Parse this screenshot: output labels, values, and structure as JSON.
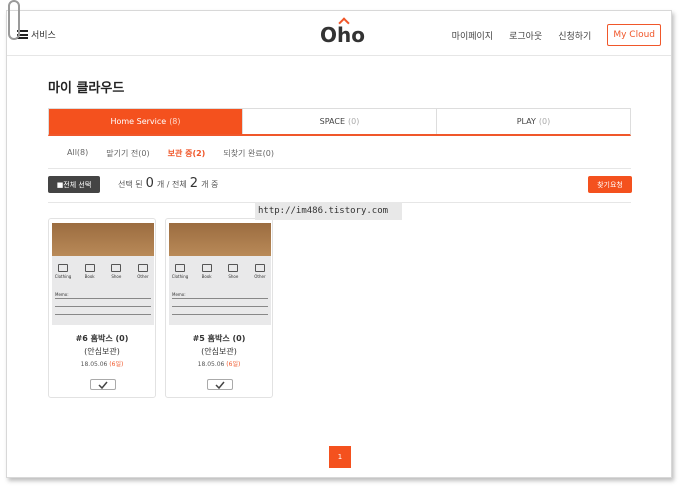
{
  "header": {
    "menu_label": "서비스",
    "logo": "Oho",
    "nav": [
      "마이페이지",
      "로그아웃",
      "신청하기"
    ],
    "cloud_button": "My Cloud"
  },
  "page": {
    "title": "마이 클라우드"
  },
  "tabs": [
    {
      "label": "Home Service",
      "count": "(8)"
    },
    {
      "label": "SPACE",
      "count": "(0)"
    },
    {
      "label": "PLAY",
      "count": "(0)"
    }
  ],
  "subtabs": [
    "All(8)",
    "맡기기 전(0)",
    "보관 중(2)",
    "되찾기 완료(0)"
  ],
  "toolbar": {
    "select_all": "■전체 선택",
    "selected_prefix": "선택 된",
    "selected_count": "0",
    "mid_text": "개 / 전체",
    "total_count": "2",
    "suffix": "개 중",
    "find_button": "찾기요청"
  },
  "overlay_url": "http://im486.tistory.com",
  "photo_labels": {
    "clothing": "Clothing",
    "book": "Book",
    "shoe": "Shoe",
    "other": "Other",
    "memo": "Memo:"
  },
  "cards": [
    {
      "title": "#6 홈박스 (0)",
      "sub": "(안심보관)",
      "date": "18.05.06",
      "days": "(6일)"
    },
    {
      "title": "#5 홈박스 (0)",
      "sub": "(안심보관)",
      "date": "18.05.06",
      "days": "(6일)"
    }
  ],
  "pagination": {
    "current": "1"
  },
  "colors": {
    "accent": "#f4511e",
    "dark_button": "#444444"
  }
}
